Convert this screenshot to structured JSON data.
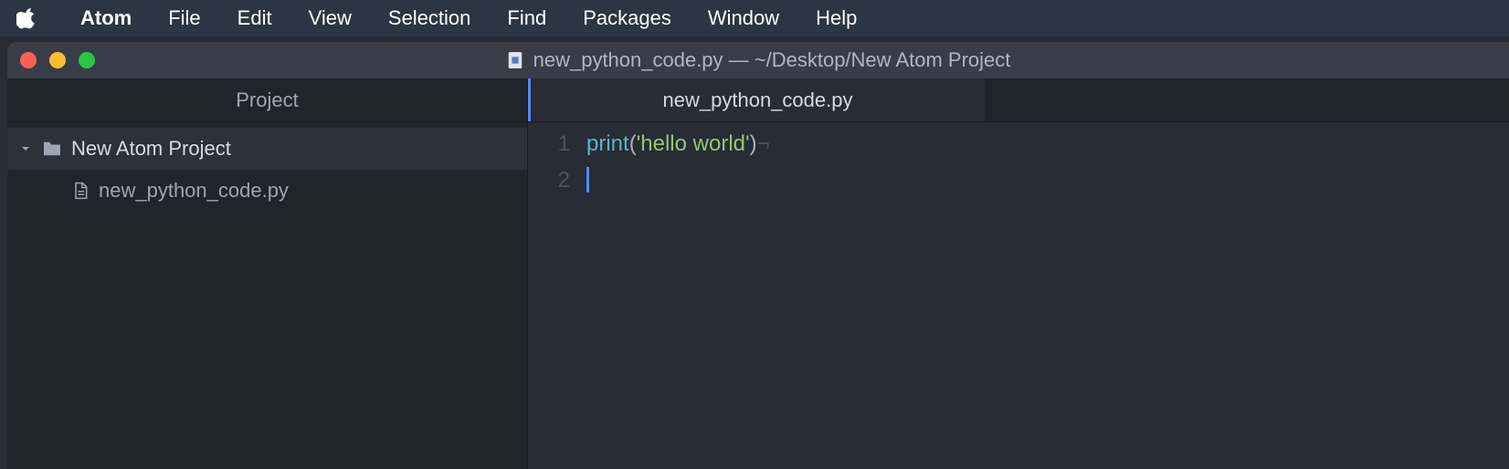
{
  "menubar": {
    "app": "Atom",
    "items": [
      "File",
      "Edit",
      "View",
      "Selection",
      "Find",
      "Packages",
      "Window",
      "Help"
    ]
  },
  "window": {
    "title": "new_python_code.py — ~/Desktop/New Atom Project"
  },
  "sidebar": {
    "header": "Project",
    "root": {
      "name": "New Atom Project",
      "expanded": true,
      "children": [
        {
          "name": "new_python_code.py"
        }
      ]
    }
  },
  "editor": {
    "tab": "new_python_code.py",
    "gutter": [
      "1",
      "2"
    ],
    "code": {
      "line1": {
        "builtin": "print",
        "open": "(",
        "string": "'hello world'",
        "close": ")",
        "eol": "¬"
      }
    }
  }
}
